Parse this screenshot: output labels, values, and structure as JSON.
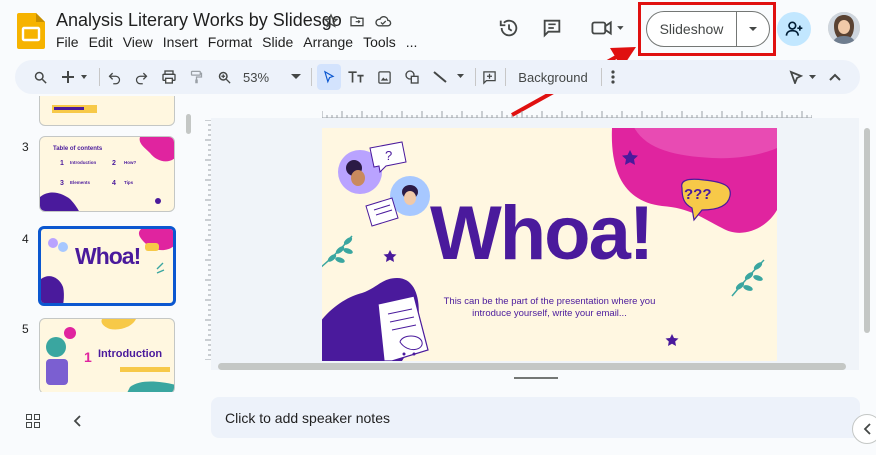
{
  "title": "Analysis Literary Works by Slidesgo",
  "menu": [
    "File",
    "Edit",
    "View",
    "Insert",
    "Format",
    "Slide",
    "Arrange",
    "Tools",
    "..."
  ],
  "slideshow_label": "Slideshow",
  "toolbar": {
    "zoom": "53%",
    "background_label": "Background"
  },
  "slides": [
    {
      "number": "3",
      "title": "Table of contents",
      "items": [
        "Introduction",
        "How?",
        "Elements",
        "Tips"
      ],
      "nums": [
        "1",
        "2",
        "3",
        "4"
      ]
    },
    {
      "number": "4",
      "title": "Whoa!",
      "selected": true
    },
    {
      "number": "5",
      "title": "Introduction",
      "num": "1"
    }
  ],
  "main_slide": {
    "heading": "Whoa!",
    "body_line1": "This can be the part of the presentation where you",
    "body_line2": "introduce yourself, write your email...",
    "bubble": "???"
  },
  "notes_placeholder": "Click to add speaker notes",
  "colors": {
    "accent_purple": "#4a1a9c",
    "accent_magenta": "#e0249f",
    "slide_bg": "#fff7e1",
    "highlight_red": "#e01010",
    "arrow_red": "#e01010",
    "selected_blue": "#0b57d0"
  }
}
